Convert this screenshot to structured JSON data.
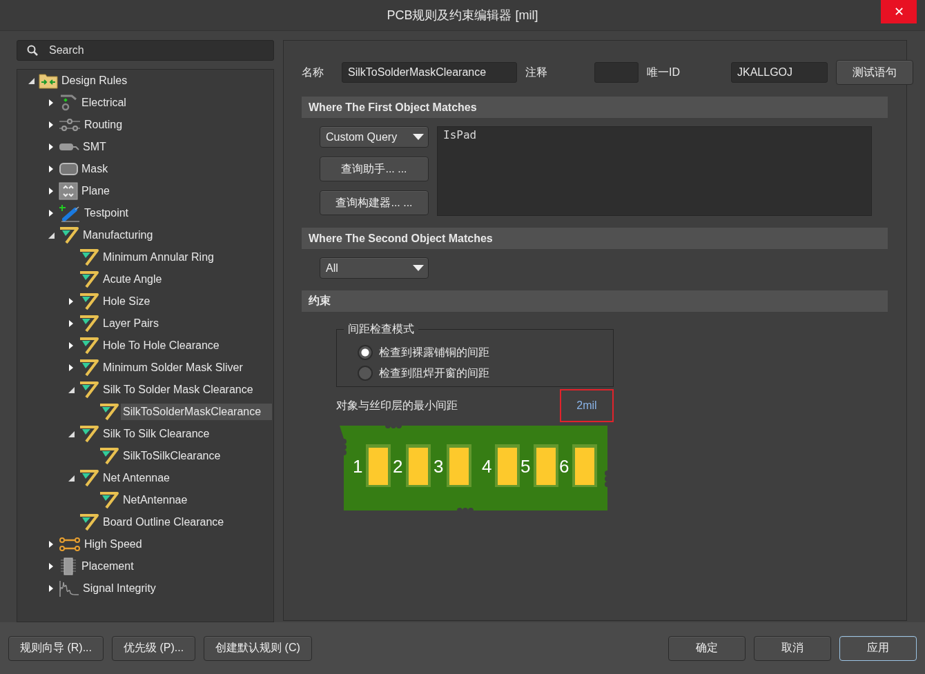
{
  "window": {
    "title": "PCB规则及约束编辑器 [mil]",
    "close": "✕"
  },
  "search": {
    "placeholder": "Search"
  },
  "tree": [
    {
      "label": "Design Rules",
      "kind": "folder",
      "expanded": true,
      "selected": false,
      "children": [
        {
          "label": "Electrical",
          "kind": "electrical",
          "expanded": false,
          "selected": false
        },
        {
          "label": "Routing",
          "kind": "routing",
          "expanded": false,
          "selected": false
        },
        {
          "label": "SMT",
          "kind": "smt",
          "expanded": false,
          "selected": false
        },
        {
          "label": "Mask",
          "kind": "mask",
          "expanded": false,
          "selected": false
        },
        {
          "label": "Plane",
          "kind": "plane",
          "expanded": false,
          "selected": false
        },
        {
          "label": "Testpoint",
          "kind": "testpoint",
          "expanded": false,
          "selected": false
        },
        {
          "label": "Manufacturing",
          "kind": "rule",
          "expanded": true,
          "selected": false,
          "children": [
            {
              "label": "Minimum Annular Ring",
              "kind": "rule",
              "selected": false
            },
            {
              "label": "Acute Angle",
              "kind": "rule",
              "selected": false
            },
            {
              "label": "Hole Size",
              "kind": "rule",
              "expanded": false,
              "selected": false
            },
            {
              "label": "Layer Pairs",
              "kind": "rule",
              "expanded": false,
              "selected": false
            },
            {
              "label": "Hole To Hole Clearance",
              "kind": "rule",
              "expanded": false,
              "selected": false
            },
            {
              "label": "Minimum Solder Mask Sliver",
              "kind": "rule",
              "expanded": false,
              "selected": false
            },
            {
              "label": "Silk To Solder Mask Clearance",
              "kind": "rule",
              "expanded": true,
              "selected": false,
              "children": [
                {
                  "label": "SilkToSolderMaskClearance",
                  "kind": "rule",
                  "selected": true
                }
              ]
            },
            {
              "label": "Silk To Silk Clearance",
              "kind": "rule",
              "expanded": true,
              "selected": false,
              "children": [
                {
                  "label": "SilkToSilkClearance",
                  "kind": "rule",
                  "selected": false
                }
              ]
            },
            {
              "label": "Net Antennae",
              "kind": "rule",
              "expanded": true,
              "selected": false,
              "children": [
                {
                  "label": "NetAntennae",
                  "kind": "rule",
                  "selected": false
                }
              ]
            },
            {
              "label": "Board Outline Clearance",
              "kind": "rule",
              "selected": false
            }
          ]
        },
        {
          "label": "High Speed",
          "kind": "highspeed",
          "expanded": false,
          "selected": false
        },
        {
          "label": "Placement",
          "kind": "placement",
          "expanded": false,
          "selected": false
        },
        {
          "label": "Signal Integrity",
          "kind": "signal",
          "expanded": false,
          "selected": false
        }
      ]
    }
  ],
  "rule": {
    "name_label": "名称",
    "name": "SilkToSolderMaskClearance",
    "comment_label": "注释",
    "id_label": "唯一ID",
    "id": "JKALLGOJ",
    "test_button": "测试语句"
  },
  "first_match": {
    "title": "Where The First Object Matches",
    "dropdown": "Custom Query",
    "buttons": [
      "查询助手... ...",
      "查询构建器... ..."
    ],
    "query": "IsPad"
  },
  "second_match": {
    "title": "Where The Second Object Matches",
    "dropdown": "All"
  },
  "constraints": {
    "title": "约束",
    "group_title": "间距检查模式",
    "options": [
      {
        "label": "检查到裸露铺铜的间距",
        "selected": true
      },
      {
        "label": "检查到阻焊开窗的间距",
        "selected": false
      }
    ],
    "min_label": "对象与丝印层的最小间距",
    "min_value": "2mil",
    "pads": [
      "1",
      "2",
      "3",
      "4",
      "5",
      "6"
    ]
  },
  "buttons_left": [
    "规则向导 (R)...",
    "优先级 (P)...",
    "创建默认规则 (C)"
  ],
  "buttons_right": [
    {
      "label": "确定",
      "focused": false
    },
    {
      "label": "取消",
      "focused": false
    },
    {
      "label": "应用",
      "focused": true
    }
  ]
}
